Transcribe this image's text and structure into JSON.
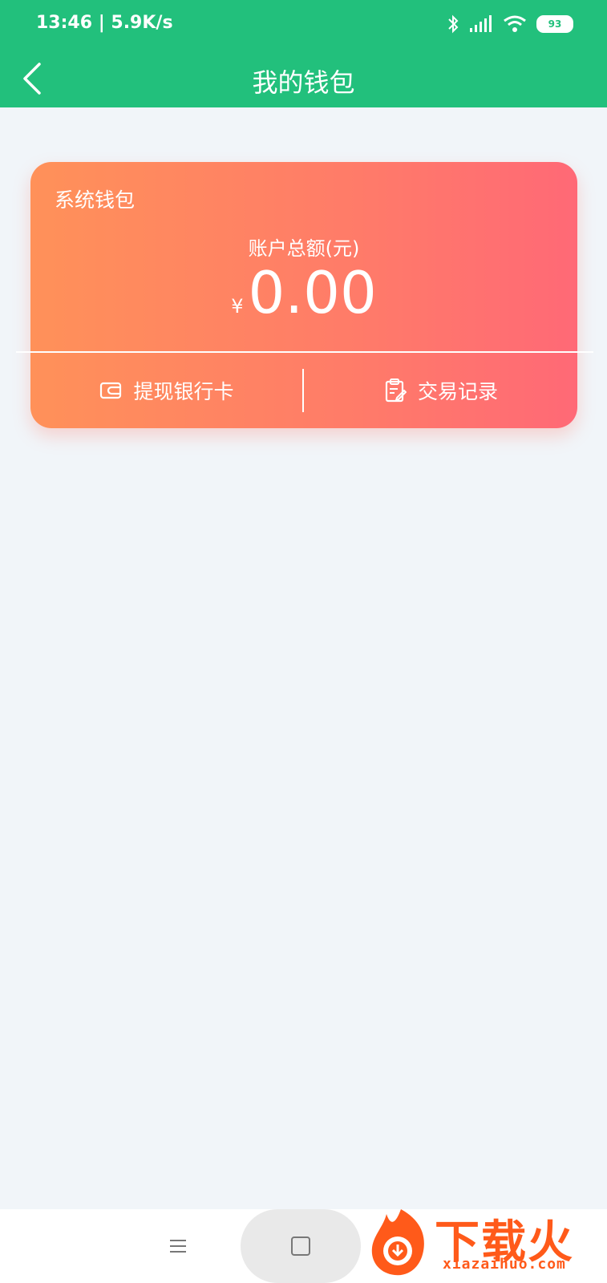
{
  "status_bar": {
    "time_speed": "13:46 | 5.9K/s",
    "battery": "93"
  },
  "header": {
    "title": "我的钱包"
  },
  "wallet": {
    "name": "系统钱包",
    "amount_label": "账户总额(元)",
    "currency_symbol": "¥",
    "amount": "0.00",
    "actions": [
      {
        "label": "提现银行卡",
        "icon": "wallet-icon"
      },
      {
        "label": "交易记录",
        "icon": "clipboard-edit-icon"
      }
    ]
  },
  "colors": {
    "header": "#22c07c",
    "card_start": "#ff9159",
    "card_end": "#ff6976",
    "background": "#f1f5f9"
  },
  "watermark": {
    "text": "下载火",
    "url": "xiazaihuo.com"
  }
}
